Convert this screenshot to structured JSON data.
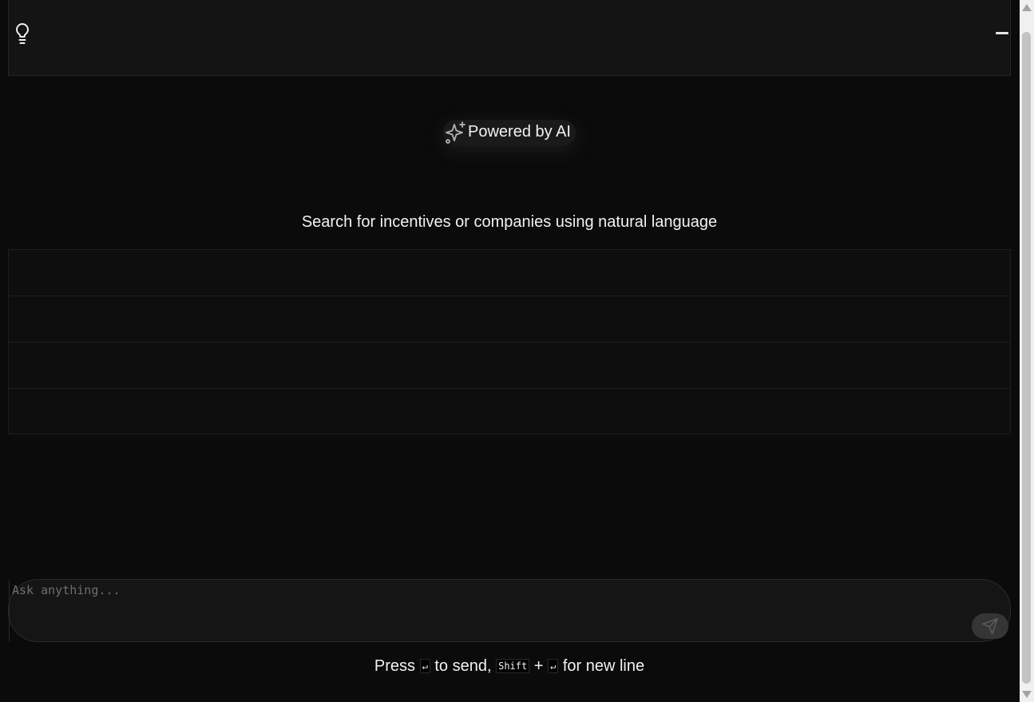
{
  "header": {
    "logo_icon": "lightbulb-icon",
    "menu_icon": "menu-icon"
  },
  "badge": {
    "icon": "sparkles-icon",
    "label": "Powered by AI"
  },
  "subtitle": "Search for incentives or companies using natural language",
  "suggestions": [
    "",
    "",
    "",
    ""
  ],
  "input": {
    "placeholder": "Ask anything...",
    "value": "",
    "send_icon": "send-icon"
  },
  "hint": {
    "press": "Press",
    "enter_key": "↵",
    "to_send": "to send,",
    "shift_key": "Shift",
    "plus": "+",
    "enter_key2": "↵",
    "for_new_line": "for new line"
  },
  "colors": {
    "background": "#0b0b0b",
    "header": "#141414",
    "text": "#f2f2f2",
    "send_button": "#353535"
  }
}
